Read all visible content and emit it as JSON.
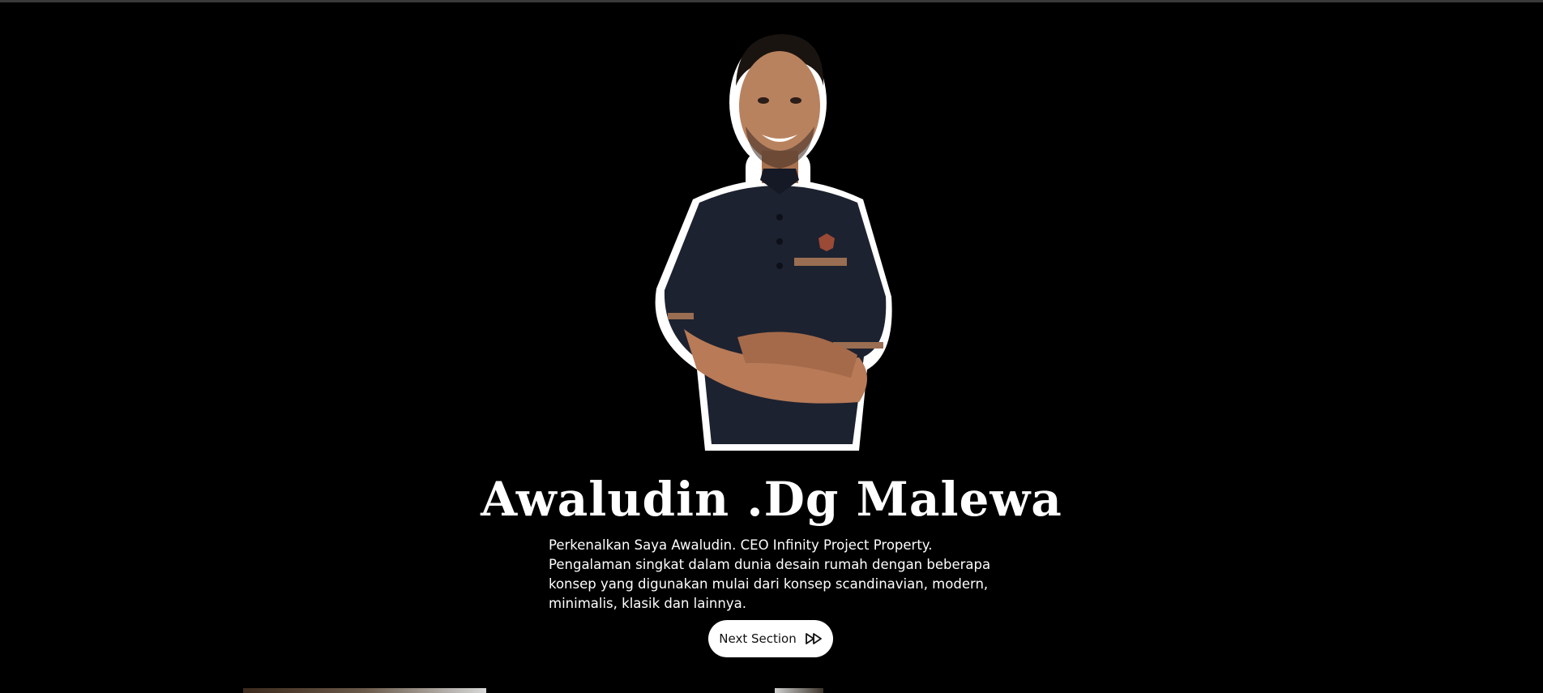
{
  "hero": {
    "name": "Awaludin .Dg Malewa",
    "intro": "Perkenalkan Saya Awaludin. CEO Infinity Project Property. Pengalaman singkat dalam dunia desain rumah dengan beberapa konsep yang digunakan mulai dari konsep scandinavian, modern, minimalis, klasik dan lainnya.",
    "next_button_label": "Next Section",
    "next_button_icon": "fast-forward-icon"
  },
  "colors": {
    "background": "#000000",
    "text": "#ffffff",
    "button_bg": "#ffffff",
    "button_text": "#111111"
  }
}
